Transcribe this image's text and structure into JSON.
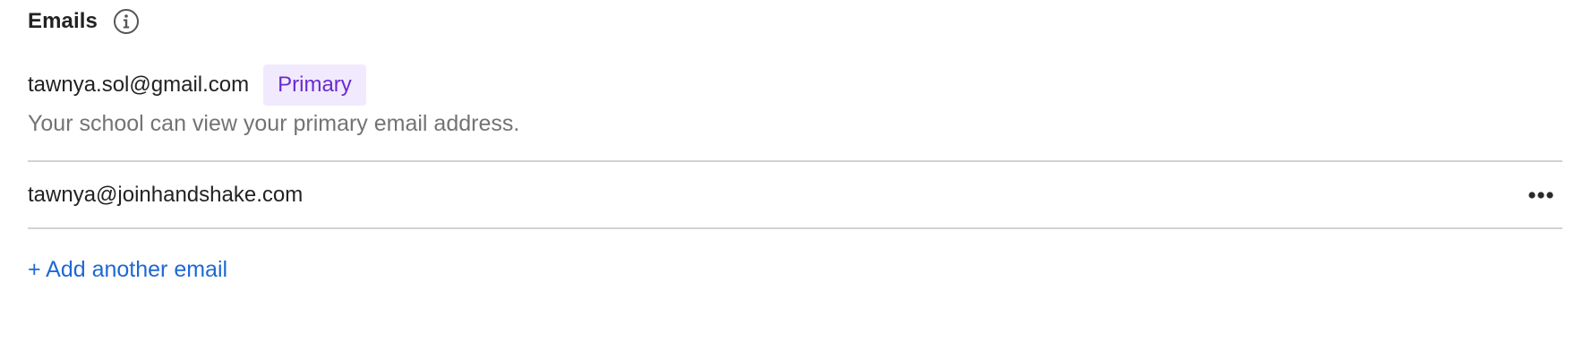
{
  "emails_section": {
    "title": "Emails",
    "info_icon": "info-circle-icon",
    "primary": {
      "email": "tawnya.sol@gmail.com",
      "badge": "Primary",
      "helper_text": "Your school can view your primary email address."
    },
    "secondary": [
      {
        "email": "tawnya@joinhandshake.com",
        "menu_icon": "more-horizontal-icon"
      }
    ],
    "add_link": "+ Add another email"
  },
  "colors": {
    "badge_bg": "#f1eafe",
    "badge_text": "#6a2bd0",
    "link": "#1f68d3",
    "muted_text": "#737373",
    "divider": "#d2d2d2"
  }
}
